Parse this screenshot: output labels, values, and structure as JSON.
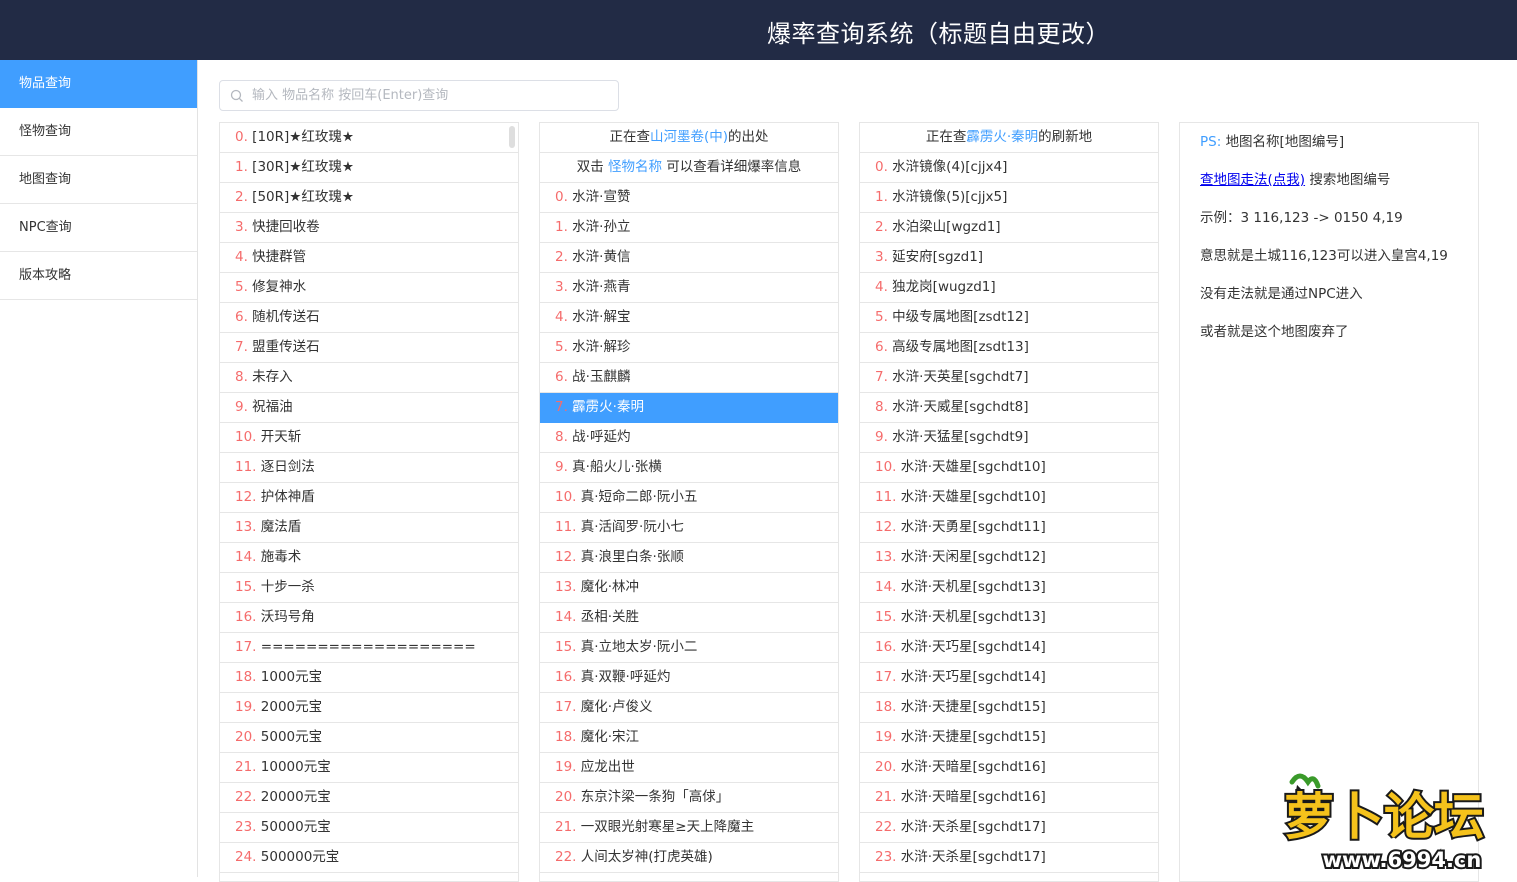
{
  "header": {
    "title": "爆率查询系统（标题自由更改）"
  },
  "sidebar": {
    "items": [
      {
        "label": "物品查询",
        "active": true
      },
      {
        "label": "怪物查询",
        "active": false
      },
      {
        "label": "地图查询",
        "active": false
      },
      {
        "label": "NPC查询",
        "active": false
      },
      {
        "label": "版本攻略",
        "active": false
      }
    ]
  },
  "search": {
    "placeholder": "输入 物品名称 按回车(Enter)查询",
    "value": ""
  },
  "items_list": [
    "[10R]★红玫瑰★",
    "[30R]★红玫瑰★",
    "[50R]★红玫瑰★",
    "快捷回收卷",
    "快捷群管",
    "修复神水",
    "随机传送石",
    "盟重传送石",
    "未存入",
    "祝福油",
    "开天斩",
    "逐日剑法",
    "护体神盾",
    "魔法盾",
    "施毒术",
    "十步一杀",
    "沃玛号角",
    "===================",
    "1000元宝",
    "2000元宝",
    "5000元宝",
    "10000元宝",
    "20000元宝",
    "50000元宝",
    "500000元宝"
  ],
  "monsters_panel": {
    "header_prefix": "正在查",
    "header_item": "山河墨卷(中)",
    "header_suffix": "的出处",
    "hint_prefix": "双击",
    "hint_highlight": "怪物名称",
    "hint_suffix": "可以查看详细爆率信息",
    "selected_index": 7,
    "items": [
      "水浒·宣赞",
      "水浒·孙立",
      "水浒·黄信",
      "水浒·燕青",
      "水浒·解宝",
      "水浒·解珍",
      "战·玉麒麟",
      "霹雳火·秦明",
      "战·呼延灼",
      "真·船火儿·张横",
      "真·短命二郎·阮小五",
      "真·活阎罗·阮小七",
      "真·浪里白条·张顺",
      "魔化·林冲",
      "丞相·关胜",
      "真·立地太岁·阮小二",
      "真·双鞭·呼延灼",
      "魔化·卢俊义",
      "魔化·宋江",
      "应龙出世",
      "东京汴梁一条狗「高俅」",
      "一双眼光射寒星≥天上降魔主",
      "人间太岁神(打虎英雄)"
    ]
  },
  "maps_panel": {
    "header_prefix": "正在查",
    "header_item": "霹雳火·秦明",
    "header_suffix": "的刷新地",
    "items": [
      "水浒镜像(4)[cjjx4]",
      "水浒镜像(5)[cjjx5]",
      "水泊梁山[wgzd1]",
      "延安府[sgzd1]",
      "独龙岗[wugzd1]",
      "中级专属地图[zsdt12]",
      "高级专属地图[zsdt13]",
      "水浒·天英星[sgchdt7]",
      "水浒·天威星[sgchdt8]",
      "水浒·天猛星[sgchdt9]",
      "水浒·天雄星[sgchdt10]",
      "水浒·天雄星[sgchdt10]",
      "水浒·天勇星[sgchdt11]",
      "水浒·天闲星[sgchdt12]",
      "水浒·天机星[sgchdt13]",
      "水浒·天机星[sgchdt13]",
      "水浒·天巧星[sgchdt14]",
      "水浒·天巧星[sgchdt14]",
      "水浒·天捷星[sgchdt15]",
      "水浒·天捷星[sgchdt15]",
      "水浒·天暗星[sgchdt16]",
      "水浒·天暗星[sgchdt16]",
      "水浒·天杀星[sgchdt17]",
      "水浒·天杀星[sgchdt17]"
    ]
  },
  "info_panel": {
    "ps_label": "PS:",
    "ps_text": "地图名称[地图编号]",
    "link_text": "查地图走法(点我)",
    "link_suffix": "搜索地图编号",
    "example": "示例：3 116,123 -> 0150 4,19",
    "meaning": "意思就是土城116,123可以进入皇宫4,19",
    "no_route": "没有走法就是通过NPC进入",
    "abandoned": "或者就是这个地图废弃了"
  },
  "watermark": {
    "text": "萝卜论坛",
    "url": "www.6994.cn"
  },
  "colors": {
    "header_bg": "#222b45",
    "accent": "#409eff",
    "index": "#f56c6c"
  }
}
